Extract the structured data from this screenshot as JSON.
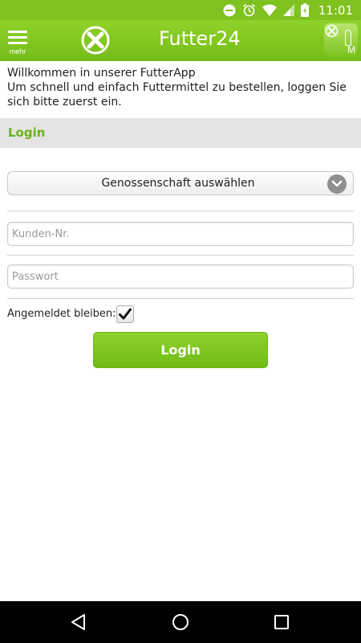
{
  "status_bar": {
    "time": "11:01",
    "icons": [
      "dnd-icon",
      "alarm-icon",
      "wifi-icon",
      "signal-icon",
      "battery-icon"
    ]
  },
  "header": {
    "menu_label": "mehr",
    "title": "Futter24",
    "corner_letter": "M"
  },
  "intro": {
    "line1": "Willkommen in unserer FutterApp",
    "line2": "Um schnell und einfach Futtermittel zu bestellen, loggen Sie sich bitte zuerst ein."
  },
  "login_section": {
    "title": "Login"
  },
  "form": {
    "cooperative_select": "Genossenschaft auswählen",
    "customer_number": {
      "value": "",
      "placeholder": "Kunden-Nr."
    },
    "password": {
      "value": "",
      "placeholder": "Passwort"
    },
    "remember_label": "Angemeldet bleiben:",
    "remember_checked": true,
    "login_button": "Login"
  },
  "colors": {
    "accent": "#7fc11f",
    "section_title": "#69b11a",
    "section_bg": "#e4e4e4"
  }
}
